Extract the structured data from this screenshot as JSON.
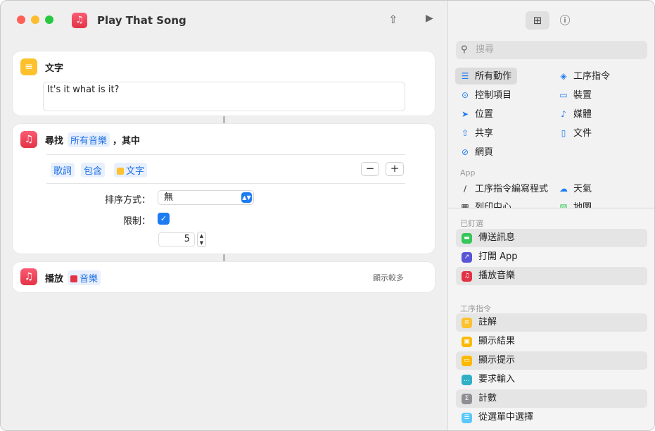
{
  "window": {
    "title": "Play That Song"
  },
  "colors": {
    "accent": "#1d7cf2",
    "music": "#e23345",
    "text_action": "#fcc12d"
  },
  "editor": {
    "text_action": {
      "label": "文字",
      "value": "It's it what is it?"
    },
    "find_action": {
      "label": "尋找",
      "source_token": "所有音樂",
      "suffix": "，其中",
      "filter": {
        "field": "歌詞",
        "operator": "包含",
        "value": "文字"
      },
      "sort_label": "排序方式：",
      "sort_value": "無",
      "limit_label": "限制：",
      "limit_checked": true,
      "limit_value": "5"
    },
    "play_action": {
      "label": "播放",
      "token": "音樂",
      "show_more": "顯示較多"
    }
  },
  "sidebar": {
    "search_placeholder": "搜尋",
    "categories": [
      {
        "label": "所有動作",
        "icon": "list-icon"
      },
      {
        "label": "工序指令",
        "icon": "shortcuts-icon"
      },
      {
        "label": "控制項目",
        "icon": "toggle-icon"
      },
      {
        "label": "裝置",
        "icon": "display-icon"
      },
      {
        "label": "位置",
        "icon": "location-icon"
      },
      {
        "label": "媒體",
        "icon": "music-note-icon"
      },
      {
        "label": "共享",
        "icon": "share-icon"
      },
      {
        "label": "文件",
        "icon": "document-icon"
      },
      {
        "label": "網頁",
        "icon": "compass-icon"
      }
    ],
    "app_header": "App",
    "apps": [
      {
        "label": "工序指令編寫程式"
      },
      {
        "label": "天氣"
      },
      {
        "label": "列印中心"
      },
      {
        "label": "地圖"
      }
    ],
    "pinned_header": "已釘選",
    "pinned": [
      {
        "label": "傳送訊息",
        "color": "#34c759"
      },
      {
        "label": "打開 App",
        "color": "#5856d6"
      },
      {
        "label": "播放音樂",
        "color": "#e23345"
      }
    ],
    "scripting_header": "工序指令",
    "scripting": [
      {
        "label": "註解",
        "color": "#fcc12d"
      },
      {
        "label": "顯示結果",
        "color": "#fcb900"
      },
      {
        "label": "顯示提示",
        "color": "#fcb900"
      },
      {
        "label": "要求輸入",
        "color": "#30b0c7"
      },
      {
        "label": "計數",
        "color": "#8e8e93"
      },
      {
        "label": "從選單中選擇",
        "color": "#5ac8fa"
      }
    ]
  }
}
